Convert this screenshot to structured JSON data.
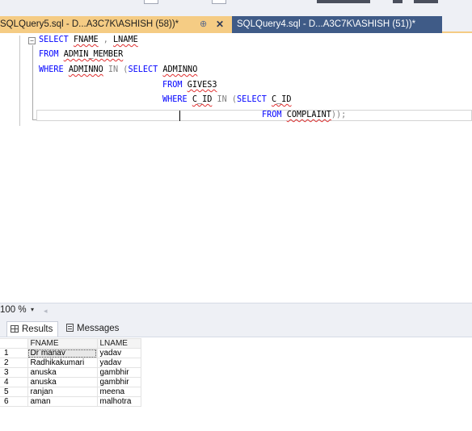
{
  "tabs": [
    {
      "label": "SQLQuery5.sql - D...A3C7K\\ASHISH (58))*",
      "pin": "⊕",
      "close": "✕",
      "active": true
    },
    {
      "label": "SQLQuery4.sql - D...A3C7K\\ASHISH (51))*",
      "active": false
    }
  ],
  "editor": {
    "collapse_symbol": "−",
    "lines": [
      "SELECT FNAME , LNAME",
      "FROM ADMIN_MEMBER",
      "WHERE ADMINNO IN (SELECT ADMINNO",
      "FROM GIVES3",
      "WHERE C_ID IN (SELECT C_ID",
      "FROM COMPLAINT));"
    ]
  },
  "zoom": {
    "value": "100 %",
    "dropdown": "▾",
    "scroll_left": "◂"
  },
  "results_tabs": [
    {
      "label": "Results",
      "icon": "grid-icon",
      "active": true
    },
    {
      "label": "Messages",
      "icon": "messages-icon",
      "active": false
    }
  ],
  "results_grid": {
    "columns": [
      "FNAME",
      "LNAME"
    ],
    "rows": [
      {
        "n": "1",
        "fname": "Dr manav",
        "lname": "yadav"
      },
      {
        "n": "2",
        "fname": "Radhikakumari",
        "lname": "yadav"
      },
      {
        "n": "3",
        "fname": "anuska",
        "lname": "gambhir"
      },
      {
        "n": "4",
        "fname": "anuska",
        "lname": "gambhir"
      },
      {
        "n": "5",
        "fname": "ranjan",
        "lname": "meena"
      },
      {
        "n": "6",
        "fname": "aman",
        "lname": "malhotra"
      }
    ]
  },
  "colors": {
    "active_tab": "#f5cc84",
    "inactive_tab": "#3f5b87",
    "keyword": "#0000ff",
    "operator": "#808080",
    "squiggle": "#e03030"
  }
}
